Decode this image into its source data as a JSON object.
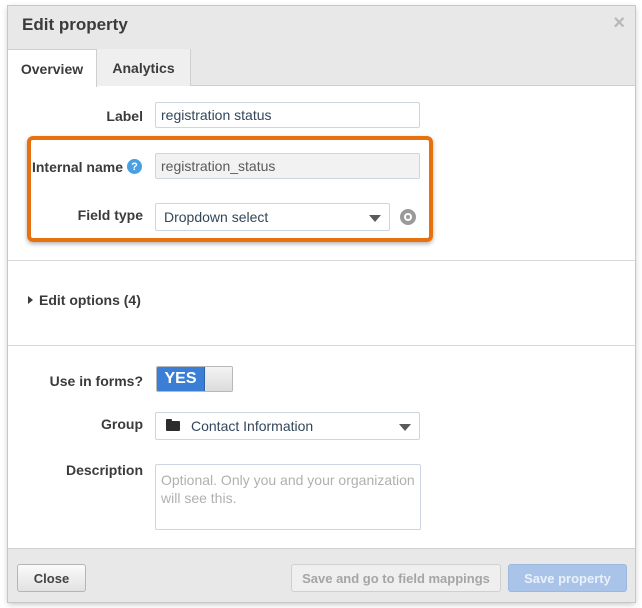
{
  "dialog": {
    "title": "Edit property",
    "close_glyph": "×"
  },
  "tabs": [
    {
      "label": "Overview",
      "active": true
    },
    {
      "label": "Analytics",
      "active": false
    }
  ],
  "fields": {
    "label": {
      "label": "Label",
      "value": "registration status"
    },
    "internal_name": {
      "label": "Internal name",
      "value": "registration_status",
      "help_glyph": "?"
    },
    "field_type": {
      "label": "Field type",
      "value": "Dropdown select"
    }
  },
  "edit_options": {
    "label": "Edit options (4)"
  },
  "use_in_forms": {
    "label": "Use in forms?",
    "toggle_text": "YES"
  },
  "group": {
    "label": "Group",
    "value": "Contact Information"
  },
  "description": {
    "label": "Description",
    "placeholder": "Optional. Only you and your organization will see this."
  },
  "footer": {
    "close_label": "Close",
    "save_mappings_label": "Save and go to field mappings",
    "save_label": "Save property"
  },
  "colors": {
    "highlight": "#e8710f",
    "toggle_on": "#3a7fd5",
    "help_icon": "#4a9fe0",
    "save_disabled": "#a9c4e8"
  },
  "icons": {
    "close": "close-icon",
    "help": "help-icon",
    "lock": "lock-icon",
    "folder": "folder-icon",
    "expand": "triangle-right-icon",
    "dropdown": "chevron-down-icon"
  }
}
